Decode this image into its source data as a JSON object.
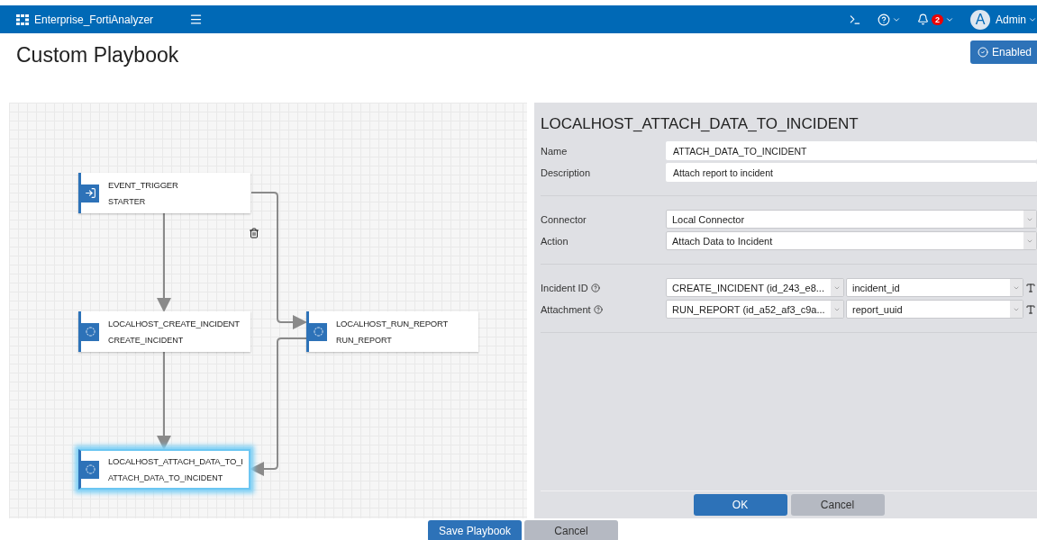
{
  "header": {
    "product": "Enterprise_FortiAnalyzer",
    "notifications": "2",
    "user_initial": "A",
    "user": "Admin"
  },
  "page": {
    "title": "Custom Playbook",
    "status": {
      "label": "Enabled",
      "on": true
    }
  },
  "canvas": {
    "nodes": [
      {
        "title": "EVENT_TRIGGER",
        "subtitle": "STARTER",
        "kind": "starter",
        "selected": false
      },
      {
        "title": "LOCALHOST_CREATE_INCIDENT",
        "subtitle": "CREATE_INCIDENT",
        "kind": "action",
        "selected": false
      },
      {
        "title": "LOCALHOST_RUN_REPORT",
        "subtitle": "RUN_REPORT",
        "kind": "action",
        "selected": false
      },
      {
        "title": "LOCALHOST_ATTACH_DATA_TO_I",
        "subtitle": "ATTACH_DATA_TO_INCIDENT",
        "kind": "action",
        "selected": true
      }
    ]
  },
  "panel": {
    "title": "LOCALHOST_ATTACH_DATA_TO_INCIDENT",
    "sections": [
      [
        {
          "label": "Name",
          "value": "ATTACH_DATA_TO_INCIDENT",
          "kind": "text"
        },
        {
          "label": "Description",
          "value": "Attach report to incident",
          "kind": "text"
        }
      ],
      [
        {
          "label": "Connector",
          "value": "Local Connector",
          "kind": "select"
        },
        {
          "label": "Action",
          "value": "Attach Data to Incident",
          "kind": "select"
        }
      ],
      [
        {
          "label": "Incident ID",
          "source": "CREATE_INCIDENT (id_243_e8...",
          "value": "incident_id",
          "kind": "param"
        },
        {
          "label": "Attachment",
          "source": "RUN_REPORT (id_a52_af3_c9a...",
          "value": "report_uuid",
          "kind": "param"
        }
      ]
    ],
    "buttons": [
      "OK",
      "Cancel"
    ]
  },
  "footer_buttons": [
    "Save Playbook",
    "Cancel"
  ]
}
